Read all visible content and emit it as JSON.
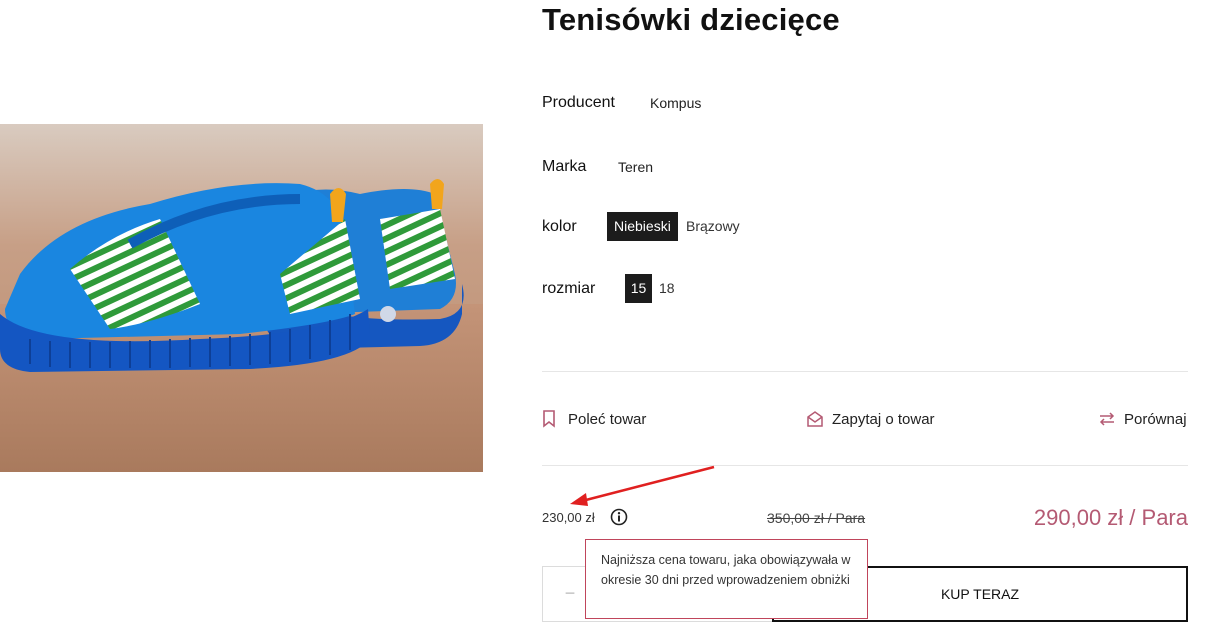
{
  "product": {
    "title": "Tenisówki dziecięce",
    "image_alt": "blue-striped-kids-sneakers"
  },
  "attributes": {
    "producer_label": "Producent",
    "producer_value": "Kompus",
    "brand_label": "Marka",
    "brand_value": "Teren",
    "color_label": "kolor",
    "color_options": [
      "Niebieski",
      "Brązowy"
    ],
    "color_selected": "Niebieski",
    "size_label": "rozmiar",
    "size_options": [
      "15",
      "18"
    ],
    "size_selected": "15"
  },
  "actions": {
    "recommend": "Poleć towar",
    "ask": "Zapytaj o towar",
    "compare": "Porównaj"
  },
  "pricing": {
    "lowest_price": "230,00 zł",
    "old_price": "350,00 zł / Para",
    "current_price": "290,00 zł / Para",
    "tooltip": "Najniższa cena towaru, jaka obowiązywała w okresie 30 dni przed wprowadzeniem obniżki"
  },
  "purchase": {
    "qty_minus": "−",
    "buy_label": "KUP TERAZ"
  },
  "colors": {
    "accent": "#b45a73",
    "tooltip_border": "#c0455b",
    "arrow": "#e02020",
    "chip_selected_bg": "#1c1c1c"
  }
}
